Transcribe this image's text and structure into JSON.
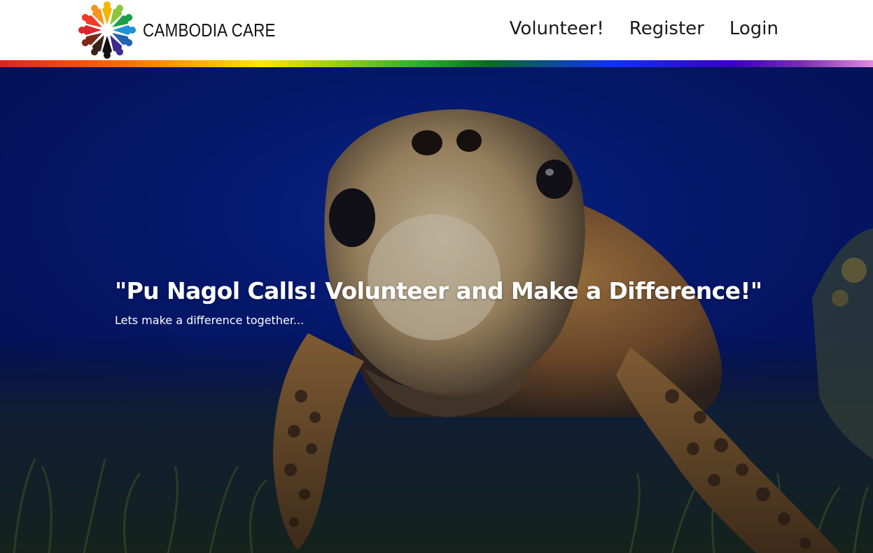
{
  "header": {
    "brand_name": "CAMBODIA CARE",
    "logo_icon": "people-circle-logo",
    "nav": [
      {
        "label": "Volunteer!"
      },
      {
        "label": "Register"
      },
      {
        "label": "Login"
      }
    ]
  },
  "hero": {
    "title": "\"Pu Nagol Calls! Volunteer and Make a Difference!\"",
    "subtitle": "Lets make a difference together..."
  },
  "colors": {
    "header_bg": "#ffffff",
    "ocean_blue": "#061d7a",
    "text_white": "#ffffff"
  }
}
